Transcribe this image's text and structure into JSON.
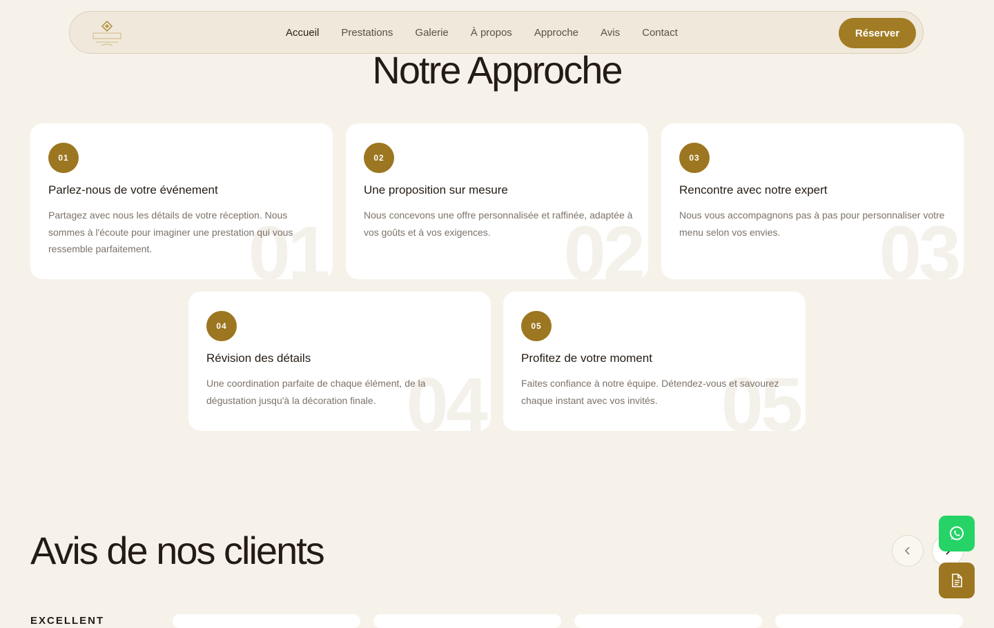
{
  "nav": {
    "links": [
      "Accueil",
      "Prestations",
      "Galerie",
      "À propos",
      "Approche",
      "Avis",
      "Contact"
    ],
    "reserve_label": "Réserver"
  },
  "approach": {
    "title": "Notre Approche",
    "steps": [
      {
        "num": "01",
        "title": "Parlez-nous de votre événement",
        "text": "Partagez avec nous les détails de votre réception. Nous sommes à l'écoute pour imaginer une prestation qui vous ressemble parfaitement."
      },
      {
        "num": "02",
        "title": "Une proposition sur mesure",
        "text": "Nous concevons une offre personnalisée et raffinée, adaptée à vos goûts et à vos exigences."
      },
      {
        "num": "03",
        "title": "Rencontre avec notre expert",
        "text": "Nous vous accompagnons pas à pas pour personnaliser votre menu selon vos envies."
      },
      {
        "num": "04",
        "title": "Révision des détails",
        "text": "Une coordination parfaite de chaque élément, de la dégustation jusqu'à la décoration finale."
      },
      {
        "num": "05",
        "title": "Profitez de votre moment",
        "text": "Faites confiance à notre équipe. Détendez-vous et savourez chaque instant avec vos invités."
      }
    ]
  },
  "reviews": {
    "title": "Avis de nos clients",
    "rating_label": "EXCELLENT"
  },
  "colors": {
    "accent": "#a27c24",
    "background": "#f6f2ea",
    "whatsapp": "#25d366"
  },
  "icons": {
    "logo": "mosaic-logo",
    "prev": "chevron-left-icon",
    "next": "chevron-right-icon",
    "whatsapp": "whatsapp-icon",
    "document": "document-icon"
  }
}
